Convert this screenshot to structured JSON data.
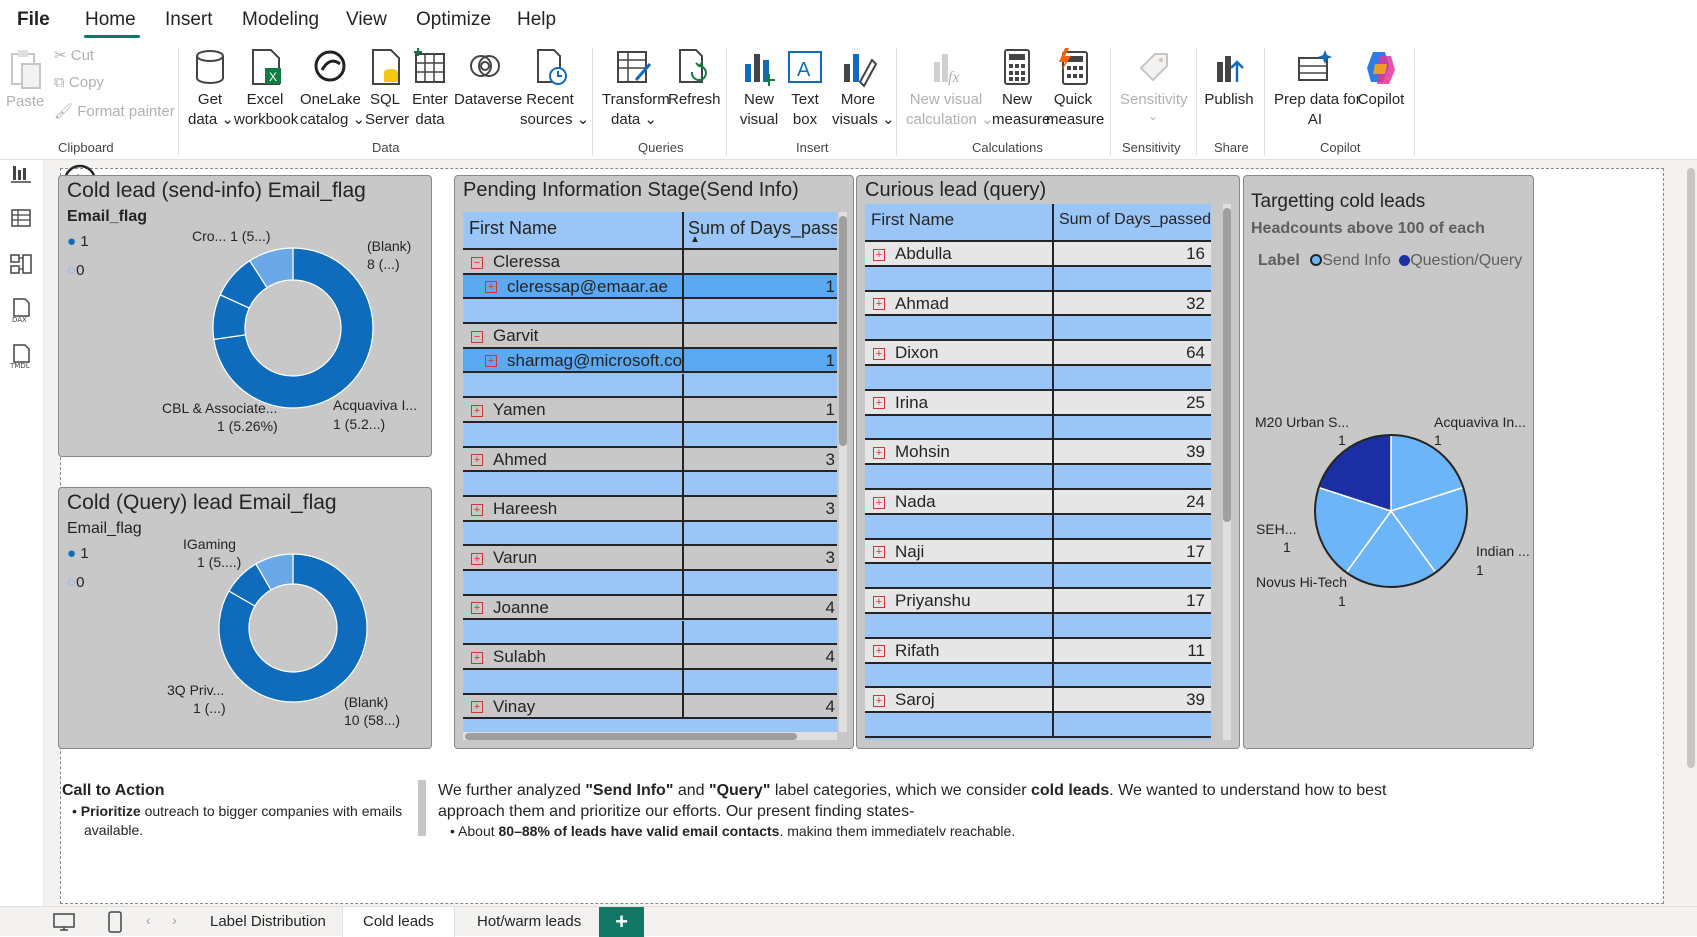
{
  "menu": {
    "file": "File",
    "home": "Home",
    "insert": "Insert",
    "modeling": "Modeling",
    "view": "View",
    "optimize": "Optimize",
    "help": "Help"
  },
  "ribbon": {
    "clipboard": {
      "paste": "Paste",
      "cut": "Cut",
      "copy": "Copy",
      "format_painter": "Format painter",
      "group": "Clipboard"
    },
    "data": {
      "get_data": [
        "Get",
        "data ⌄"
      ],
      "excel": [
        "Excel",
        "workbook"
      ],
      "onelake": [
        "OneLake",
        "catalog ⌄"
      ],
      "sql": [
        "SQL",
        "Server"
      ],
      "enter": [
        "Enter",
        "data"
      ],
      "dataverse": [
        "Dataverse",
        ""
      ],
      "recent": [
        "Recent",
        "sources ⌄"
      ],
      "group": "Data"
    },
    "queries": {
      "transform": [
        "Transform",
        "data ⌄"
      ],
      "refresh": [
        "Refresh",
        ""
      ],
      "group": "Queries"
    },
    "insert": {
      "new_visual": [
        "New",
        "visual"
      ],
      "text_box": [
        "Text",
        "box"
      ],
      "more_visuals": [
        "More",
        "visuals ⌄"
      ],
      "group": "Insert"
    },
    "calculations": {
      "new_visual_calc": [
        "New visual",
        "calculation ⌄"
      ],
      "new_measure": [
        "New",
        "measure"
      ],
      "quick_measure": [
        "Quick",
        "measure"
      ],
      "group": "Calculations"
    },
    "sensitivity": {
      "label": [
        "Sensitivity",
        "⌄"
      ],
      "group": "Sensitivity"
    },
    "share": {
      "publish": "Publish",
      "group": "Share"
    },
    "copilot": {
      "prep": [
        "Prep data for",
        "AI"
      ],
      "copilot": "Copilot",
      "group": "Copilot"
    }
  },
  "visuals": {
    "send_info_donut": {
      "title": "Cold lead (send-info) Email_flag",
      "legend_title": "Email_flag",
      "legend": [
        "1",
        "0"
      ],
      "labels": {
        "top_left": "Cro... 1 (5...)",
        "top_right_1": "(Blank)",
        "top_right_2": "8 (...)",
        "bottom_left_1": "CBL & Associate...",
        "bottom_left_2": "1 (5.26%)",
        "bottom_right_1": "Acquaviva I...",
        "bottom_right_2": "1 (5.2...)"
      }
    },
    "query_donut": {
      "title": "Cold (Query) lead Email_flag",
      "legend_title": "Email_flag",
      "legend": [
        "1",
        "0"
      ],
      "labels": {
        "top_left_1": "IGaming",
        "top_left_2": "1 (5....)",
        "bottom_left_1": "3Q Priv...",
        "bottom_left_2": "1 (...)",
        "bottom_right_1": "(Blank)",
        "bottom_right_2": "10 (58...)"
      }
    },
    "pending_table": {
      "title": "Pending Information Stage(Send Info)",
      "columns": [
        "First Name",
        "Sum of Days_passed"
      ],
      "rows": [
        {
          "name": "Cleressa",
          "value": "",
          "type": "group-open"
        },
        {
          "name": "cleressap@emaar.ae",
          "value": "1",
          "type": "child"
        },
        {
          "name": "",
          "value": "",
          "type": "blank"
        },
        {
          "name": "Garvit",
          "value": "",
          "type": "group-open"
        },
        {
          "name": "sharmag@microsoft.co",
          "value": "1",
          "type": "child"
        },
        {
          "name": "",
          "value": "",
          "type": "blank"
        },
        {
          "name": "Yamen",
          "value": "1",
          "type": "group"
        },
        {
          "name": "",
          "value": "",
          "type": "blank"
        },
        {
          "name": "Ahmed",
          "value": "3",
          "type": "group"
        },
        {
          "name": "",
          "value": "",
          "type": "blank"
        },
        {
          "name": "Hareesh",
          "value": "3",
          "type": "group"
        },
        {
          "name": "",
          "value": "",
          "type": "blank"
        },
        {
          "name": "Varun",
          "value": "3",
          "type": "group"
        },
        {
          "name": "",
          "value": "",
          "type": "blank"
        },
        {
          "name": "Joanne",
          "value": "4",
          "type": "group"
        },
        {
          "name": "",
          "value": "",
          "type": "blank"
        },
        {
          "name": "Sulabh",
          "value": "4",
          "type": "group"
        },
        {
          "name": "",
          "value": "",
          "type": "blank"
        },
        {
          "name": "Vinay",
          "value": "4",
          "type": "group"
        }
      ]
    },
    "curious_table": {
      "title": "Curious lead (query)",
      "columns": [
        "First Name",
        "Sum of Days_passed"
      ],
      "rows": [
        {
          "name": "Abdulla",
          "value": "16"
        },
        {
          "name": "Ahmad",
          "value": "32"
        },
        {
          "name": "Dixon",
          "value": "64"
        },
        {
          "name": "Irina",
          "value": "25"
        },
        {
          "name": "Mohsin",
          "value": "39"
        },
        {
          "name": "Nada",
          "value": "24"
        },
        {
          "name": "Naji",
          "value": "17"
        },
        {
          "name": "Priyanshu",
          "value": "17"
        },
        {
          "name": "Rifath",
          "value": "11"
        },
        {
          "name": "Saroj",
          "value": "39"
        }
      ]
    },
    "targeting_pie": {
      "title": "Targetting cold leads",
      "subtitle": "Headcounts above 100 of each",
      "legend_title": "Label",
      "legend": [
        "Send Info",
        "Question/Query"
      ],
      "labels": {
        "m20_1": "M20 Urban S...",
        "m20_2": "1",
        "acq_1": "Acquaviva In...",
        "acq_2": "1",
        "seh_1": "SEH...",
        "seh_2": "1",
        "indian_1": "Indian ...",
        "indian_2": "1",
        "novus_1": "Novus Hi-Tech",
        "novus_2": "1"
      }
    }
  },
  "chart_data": [
    {
      "type": "pie",
      "title": "Cold lead (send-info) Email_flag",
      "categories": [
        "(Blank)",
        "Acquaviva I...",
        "CBL & Associate...",
        "Cro..."
      ],
      "values": [
        8,
        1,
        1,
        1
      ]
    },
    {
      "type": "pie",
      "title": "Cold (Query) lead Email_flag",
      "categories": [
        "(Blank)",
        "3Q Priv...",
        "IGaming"
      ],
      "values": [
        10,
        1,
        1
      ]
    },
    {
      "type": "pie",
      "title": "Targetting cold leads",
      "categories": [
        "M20 Urban S...",
        "Acquaviva In...",
        "Indian ...",
        "Novus Hi-Tech",
        "SEH..."
      ],
      "values": [
        1,
        1,
        1,
        1,
        1
      ]
    }
  ],
  "textbox_left": {
    "heading": "Call to Action",
    "bullet_bold": "Prioritize",
    "bullet_rest": " outreach to bigger companies with emails",
    "bullet_cont": "available."
  },
  "textbox_right": {
    "l1a": "We further analyzed ",
    "l1b": "\"Send Info\"",
    "l1c": " and ",
    "l1d": "\"Query\"",
    "l1e": " label categories, which we consider ",
    "l1f": "cold leads",
    "l1g": ". We wanted to understand how to best",
    "l2": "approach them and prioritize our efforts. Our present finding states-",
    "l3a": "About ",
    "l3b": "80–88% of leads have valid email contacts",
    "l3c": ", making them immediately reachable."
  },
  "tabs": [
    "Label Distribution",
    "Cold leads",
    "Hot/warm leads"
  ],
  "add_tab": "+"
}
